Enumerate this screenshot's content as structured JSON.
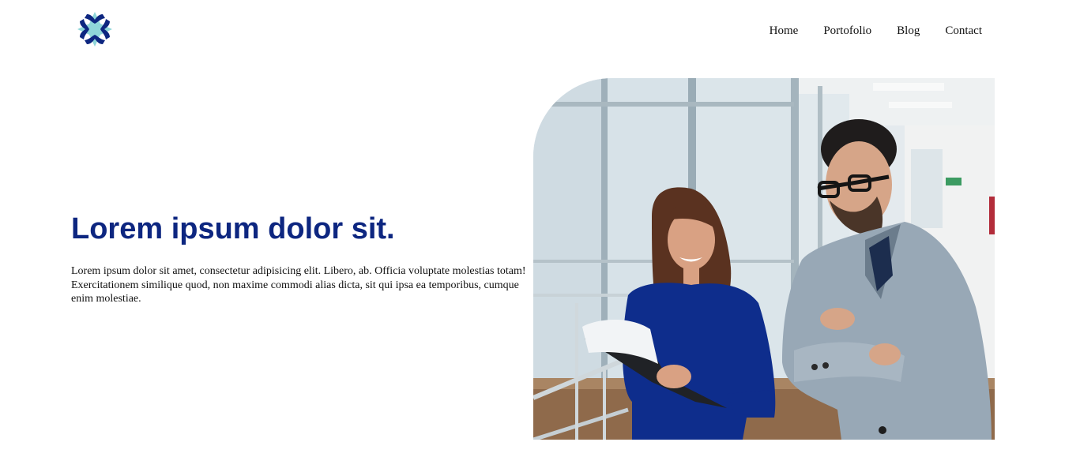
{
  "logo": {
    "icon": "four-point-star-logo-icon",
    "colors": {
      "primary": "#0d2680",
      "accent": "#8fd6d9"
    }
  },
  "nav": {
    "items": [
      "Home",
      "Portofolio",
      "Blog",
      "Contact"
    ]
  },
  "hero": {
    "title": "Lorem ipsum dolor sit.",
    "text": "Lorem ipsum dolor sit amet, consectetur adipisicing elit. Libero, ab. Officia voluptate molestias totam! Exercitationem similique quod, non maxime commodi alias dicta, sit qui ipsa ea temporibus, cumque enim molestiae.",
    "image": "office-colleagues-photo",
    "title_color": "#0d2680"
  }
}
